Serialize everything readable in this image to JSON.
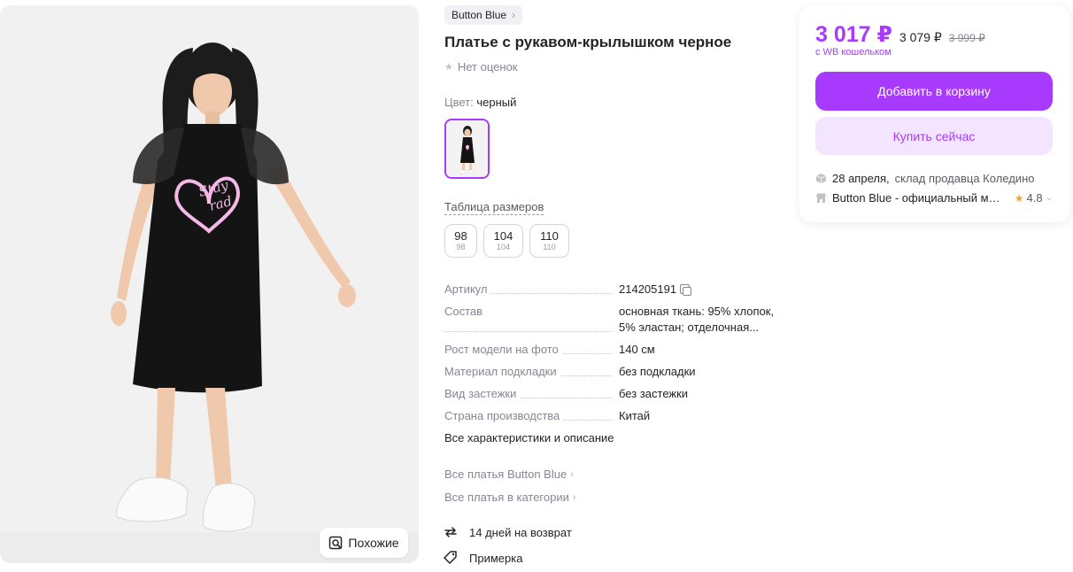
{
  "product": {
    "brand": "Button Blue",
    "title": "Платье с рукавом-крылышком черное",
    "rating_text": "Нет оценок",
    "color_label": "Цвет:",
    "color_value": "черный",
    "size_table_link": "Таблица размеров",
    "sizes": [
      {
        "main": "98",
        "sub": "98"
      },
      {
        "main": "104",
        "sub": "104"
      },
      {
        "main": "110",
        "sub": "110"
      }
    ],
    "specs": [
      {
        "key": "Артикул",
        "value": "214205191"
      },
      {
        "key": "Состав",
        "value": "основная ткань: 95% хлопок, 5% эластан; отделочная..."
      },
      {
        "key": "Рост модели на фото",
        "value": "140 см"
      },
      {
        "key": "Материал подкладки",
        "value": "без подкладки"
      },
      {
        "key": "Вид застежки",
        "value": "без застежки"
      },
      {
        "key": "Страна производства",
        "value": "Китай"
      }
    ],
    "all_characteristics": "Все характеристики и описание",
    "links": [
      "Все платья Button Blue",
      "Все платья в категории"
    ],
    "features": [
      "14 дней на возврат",
      "Примерка"
    ],
    "print_text_line1": "Stay",
    "print_text_line2": "rad"
  },
  "gallery": {
    "similar_label": "Похожие"
  },
  "buy_card": {
    "price_main": "3 017 ₽",
    "price_second": "3 079 ₽",
    "price_old": "3 999 ₽",
    "wallet_note": "с WB кошельком",
    "add_to_cart": "Добавить в корзину",
    "buy_now": "Купить сейчас",
    "delivery_date": "28 апреля,",
    "delivery_from": "склад продавца Коледино",
    "seller_name": "Button Blue - официальный магазин",
    "seller_rating": "4.8"
  },
  "colors": {
    "accent": "#a73afd",
    "accent_light": "#f3e5ff",
    "star": "#ff9f2e"
  }
}
